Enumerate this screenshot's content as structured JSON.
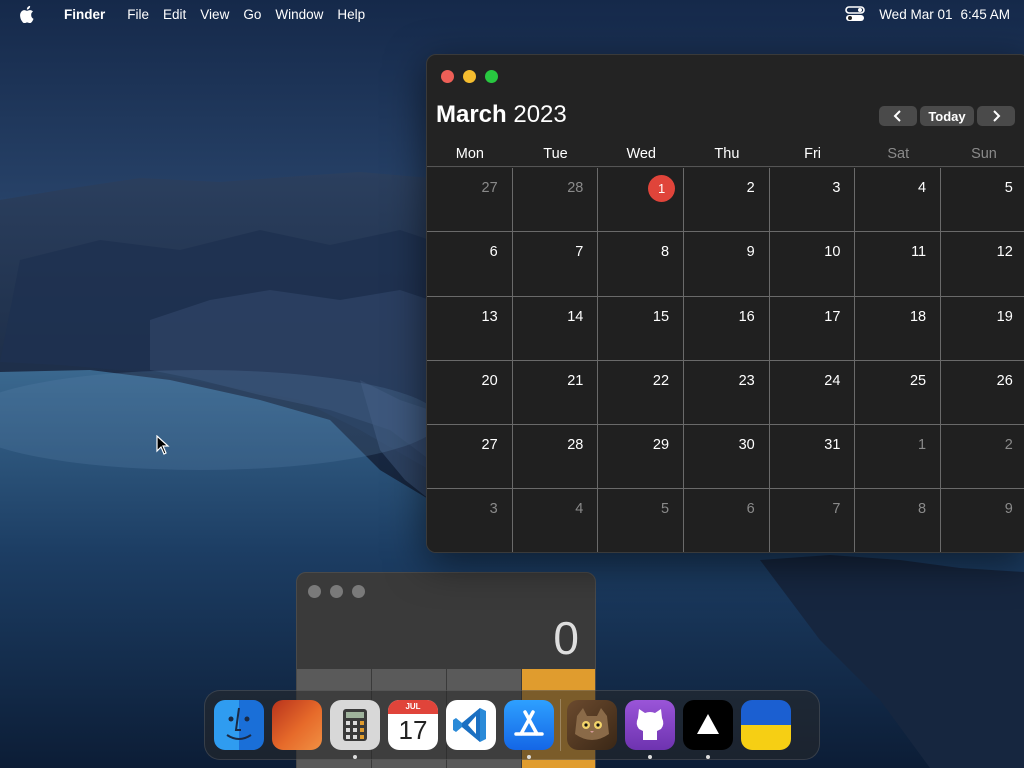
{
  "menubar": {
    "app_name": "Finder",
    "menus": [
      "File",
      "Edit",
      "View",
      "Go",
      "Window",
      "Help"
    ],
    "date": "Wed Mar 01",
    "time": "6:45 AM"
  },
  "calendar": {
    "month": "March",
    "year": "2023",
    "nav": {
      "prev": "‹",
      "today": "Today",
      "next": "›"
    },
    "weekdays": [
      "Mon",
      "Tue",
      "Wed",
      "Thu",
      "Fri",
      "Sat",
      "Sun"
    ],
    "weeks": [
      [
        {
          "d": "27",
          "m": true
        },
        {
          "d": "28",
          "m": true
        },
        {
          "d": "1",
          "today": true
        },
        {
          "d": "2"
        },
        {
          "d": "3"
        },
        {
          "d": "4"
        },
        {
          "d": "5"
        }
      ],
      [
        {
          "d": "6"
        },
        {
          "d": "7"
        },
        {
          "d": "8"
        },
        {
          "d": "9"
        },
        {
          "d": "10"
        },
        {
          "d": "11"
        },
        {
          "d": "12"
        }
      ],
      [
        {
          "d": "13"
        },
        {
          "d": "14"
        },
        {
          "d": "15"
        },
        {
          "d": "16"
        },
        {
          "d": "17"
        },
        {
          "d": "18"
        },
        {
          "d": "19"
        }
      ],
      [
        {
          "d": "20"
        },
        {
          "d": "21"
        },
        {
          "d": "22"
        },
        {
          "d": "23"
        },
        {
          "d": "24"
        },
        {
          "d": "25"
        },
        {
          "d": "26"
        }
      ],
      [
        {
          "d": "27"
        },
        {
          "d": "28"
        },
        {
          "d": "29"
        },
        {
          "d": "30"
        },
        {
          "d": "31"
        },
        {
          "d": "1",
          "m": true
        },
        {
          "d": "2",
          "m": true
        }
      ],
      [
        {
          "d": "3",
          "m": true
        },
        {
          "d": "4",
          "m": true
        },
        {
          "d": "5",
          "m": true
        },
        {
          "d": "6",
          "m": true
        },
        {
          "d": "7",
          "m": true
        },
        {
          "d": "8",
          "m": true
        },
        {
          "d": "9",
          "m": true
        }
      ]
    ]
  },
  "calculator": {
    "display": "0"
  },
  "dock": {
    "calendar_icon_month": "JUL",
    "calendar_icon_day": "17",
    "items": [
      {
        "name": "finder-icon",
        "running": true
      },
      {
        "name": "photos-icon",
        "running": false
      },
      {
        "name": "calculator-icon",
        "running": true
      },
      {
        "name": "calendar-icon",
        "running": true
      },
      {
        "name": "vscode-icon",
        "running": false
      },
      {
        "name": "app-store-icon",
        "running": true
      },
      {
        "name": "cat-app-icon",
        "running": false
      },
      {
        "name": "github-desktop-icon",
        "running": true
      },
      {
        "name": "triangle-app-icon",
        "running": true
      },
      {
        "name": "ukraine-flag-icon",
        "running": true
      }
    ]
  },
  "colors": {
    "close": "#ee5f57",
    "minimize": "#f5bd2f",
    "zoom": "#28c840",
    "today_marker": "#e0443a",
    "calc_operator": "#e09c2e"
  }
}
